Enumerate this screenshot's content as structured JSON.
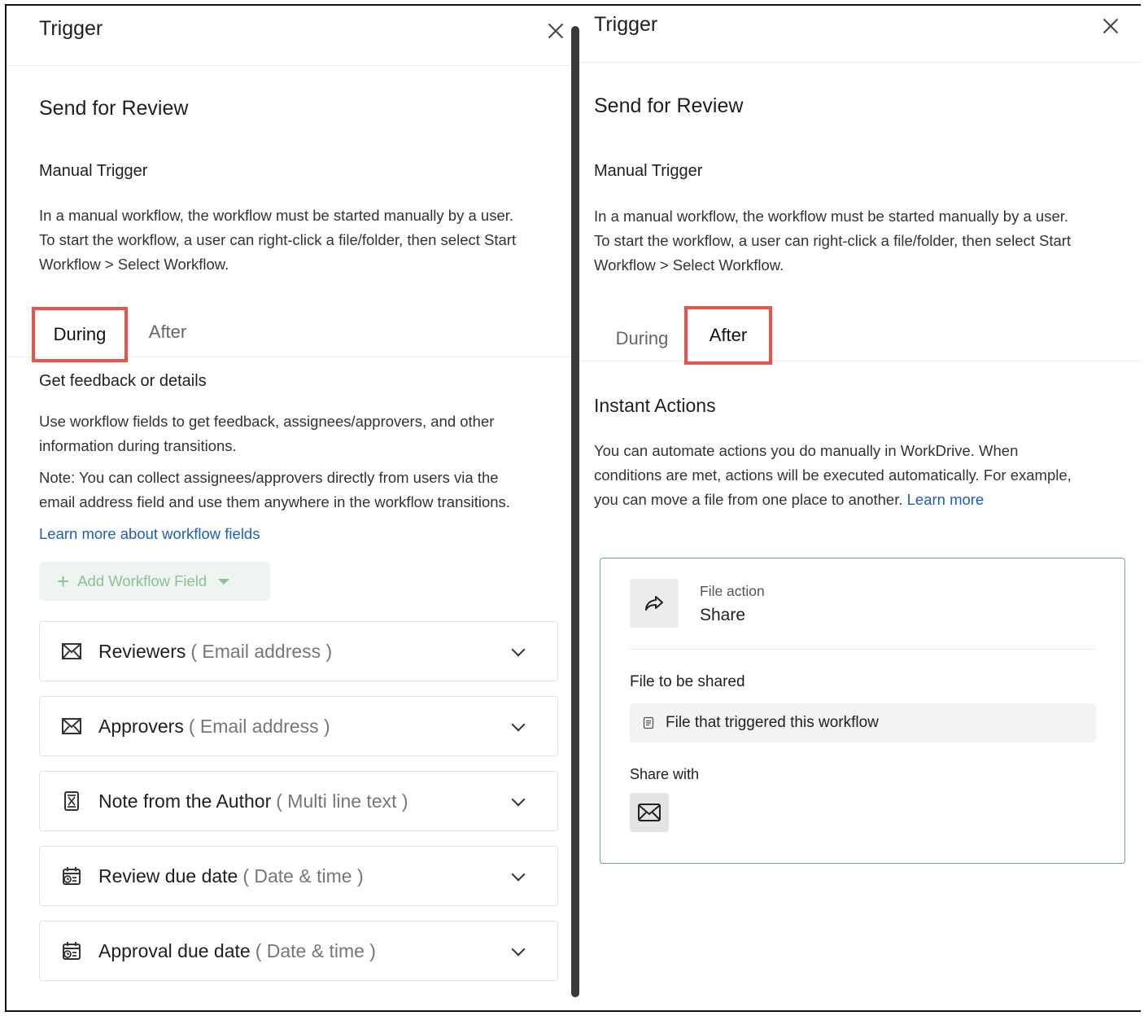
{
  "left": {
    "header_title": "Trigger",
    "workflow_name": "Send for Review",
    "trigger_type": "Manual Trigger",
    "description_lines": [
      "In a manual workflow, the workflow must be started manually by a user.",
      "To start the workflow, a user can right-click a file/folder, then select Start",
      "Workflow > Select Workflow."
    ],
    "tabs": [
      {
        "label": "During",
        "active": true
      },
      {
        "label": "After",
        "active": false
      }
    ],
    "section_title": "Get feedback or details",
    "section_desc_lines": [
      "Use workflow fields to get feedback, assignees/approvers, and other",
      "information during transitions."
    ],
    "note_lines": [
      "Note: You can collect assignees/approvers directly from users via the",
      "email address field and use them anywhere in the workflow transitions."
    ],
    "learn_more_link": "Learn more about workflow fields",
    "add_button": {
      "label": "Add Workflow Field",
      "icon": "plus-icon",
      "caret_icon": "caret-down-icon"
    },
    "fields": [
      {
        "name": "Reviewers",
        "type": "( Email address )",
        "icon": "email-icon"
      },
      {
        "name": "Approvers",
        "type": "( Email address )",
        "icon": "email-icon"
      },
      {
        "name": "Note from the Author",
        "type": "( Multi line text )",
        "icon": "text-field-icon"
      },
      {
        "name": "Review due date",
        "type": "( Date & time )",
        "icon": "calendar-clock-icon"
      },
      {
        "name": "Approval due date",
        "type": "( Date & time )",
        "icon": "calendar-clock-icon"
      }
    ]
  },
  "right": {
    "header_title": "Trigger",
    "workflow_name": "Send for Review",
    "trigger_type": "Manual Trigger",
    "description_lines": [
      "In a manual workflow, the workflow must be started manually by a user.",
      "To start the workflow, a user can right-click a file/folder, then select Start",
      "Workflow > Select Workflow."
    ],
    "tabs": [
      {
        "label": "During",
        "active": false
      },
      {
        "label": "After",
        "active": true
      }
    ],
    "section_title": "Instant Actions",
    "section_desc_lines": [
      "You can automate actions you do manually in WorkDrive. When",
      "conditions are met, actions will be executed automatically. For example,",
      "you can move a file from one place to another."
    ],
    "learn_more_link": "Learn more",
    "action_card": {
      "icon": "share-arrow-icon",
      "category_label": "File action",
      "action_name": "Share",
      "file_label": "File to be shared",
      "file_value": "File that triggered this workflow",
      "file_value_icon": "document-icon",
      "share_with_label": "Share with",
      "share_with_icon": "email-icon"
    }
  },
  "colors": {
    "tab_highlight": "#e5554a",
    "link": "#1f5fb4",
    "add_button_bg": "#eef4ef",
    "add_button_text": "#8cc098",
    "card_border": "#6fae7d"
  }
}
